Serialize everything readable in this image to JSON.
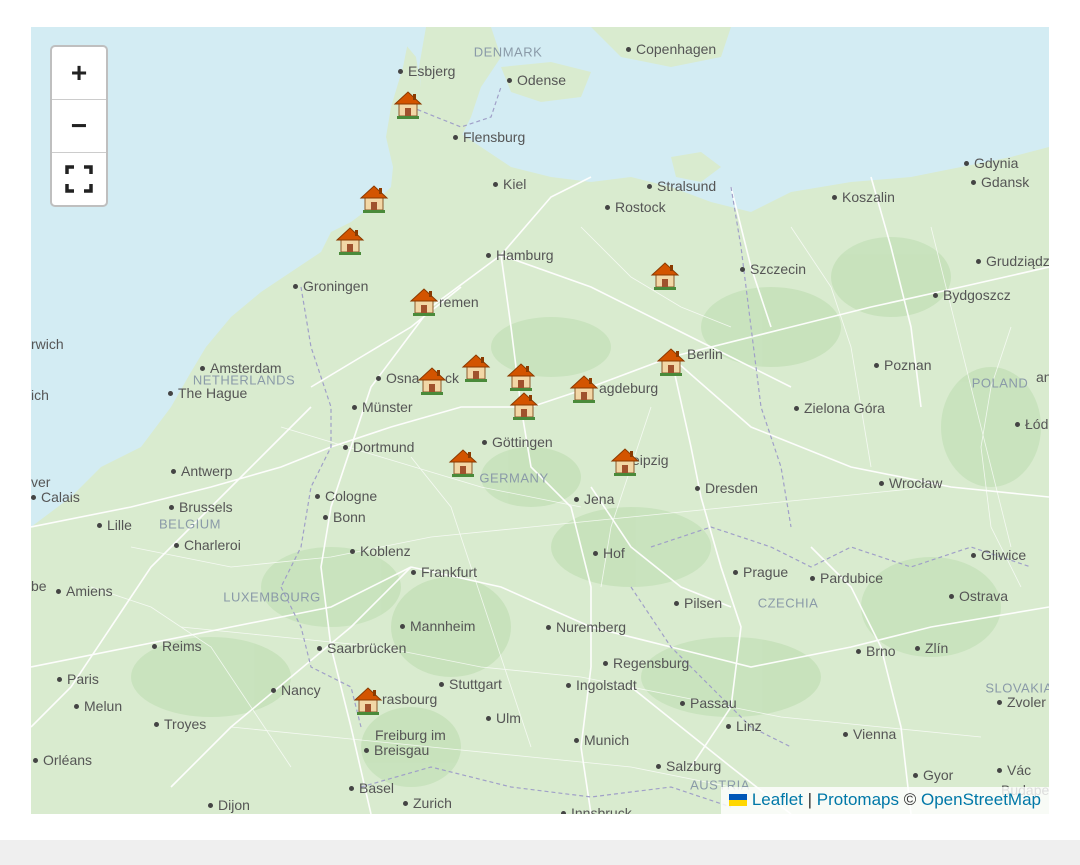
{
  "controls": {
    "zoom_in": "+",
    "zoom_out": "−",
    "fullscreen_icon": "fullscreen-icon"
  },
  "attribution": {
    "leaflet": "Leaflet",
    "sep1": "|",
    "protomaps": "Protomaps",
    "copyright": "©",
    "osm": "OpenStreetMap",
    "flag_colors": [
      "#0057b7",
      "#ffd700"
    ]
  },
  "map_colors": {
    "water": "#d3ecf3",
    "land": "#d9ebcf",
    "roads": "#ffffff",
    "marker_roof": "#d35400",
    "marker_wall": "#f2d7a6"
  },
  "countries": [
    "DENMARK",
    "NETHERLANDS",
    "BELGIUM",
    "LUXEMBOURG",
    "GERMANY",
    "POLAND",
    "CZECHIA",
    "SLOVAKIA",
    "AUSTRIA"
  ],
  "cities": [
    "Copenhagen",
    "Esbjerg",
    "Odense",
    "Flensburg",
    "Kiel",
    "Stralsund",
    "Rostock",
    "Gdynia",
    "Gdansk",
    "Koszalin",
    "Hamburg",
    "Szczecin",
    "Grudziądz",
    "Groningen",
    "remen",
    "Bydgoszcz",
    "rwich",
    "Berlin",
    "Amsterdam",
    "Poznan",
    "Osna",
    "ck",
    "The Hague",
    "agdeburg",
    "ich",
    "Münster",
    "Zielona Góra",
    "Łód",
    "Dortmund",
    "Göttingen",
    "eipzig",
    "Antwerp",
    "Wrocław",
    "ver",
    "Calais",
    "Cologne",
    "Jena",
    "Dresden",
    "Brussels",
    "Bonn",
    "Lille",
    "Charleroi",
    "Koblenz",
    "Hof",
    "Gliwice",
    "Frankfurt",
    "Prague",
    "Pardubice",
    "be",
    "Amiens",
    "Pilsen",
    "Ostrava",
    "Mannheim",
    "Nuremberg",
    "Reims",
    "Saarbrücken",
    "Brno",
    "Zlín",
    "Regensburg",
    "Paris",
    "Stuttgart",
    "Ingolstadt",
    "Nancy",
    "rasbourg",
    "Melun",
    "Passau",
    "Zvoler",
    "Ulm",
    "Troyes",
    "Linz",
    "Freiburg im",
    "Breisgau",
    "Munich",
    "Vienna",
    "Orléans",
    "Salzburg",
    "Gyor",
    "Vác",
    "Basel",
    "Dijon",
    "Zurich",
    "Innsbruck",
    "Budape",
    "an"
  ],
  "markers": [
    {
      "name": "house-marker"
    },
    {
      "name": "house-marker"
    },
    {
      "name": "house-marker"
    },
    {
      "name": "house-marker"
    },
    {
      "name": "house-marker"
    },
    {
      "name": "house-marker"
    },
    {
      "name": "house-marker"
    },
    {
      "name": "house-marker"
    },
    {
      "name": "house-marker"
    },
    {
      "name": "house-marker"
    },
    {
      "name": "house-marker"
    },
    {
      "name": "house-marker"
    },
    {
      "name": "house-marker"
    },
    {
      "name": "house-marker"
    },
    {
      "name": "house-marker"
    }
  ]
}
